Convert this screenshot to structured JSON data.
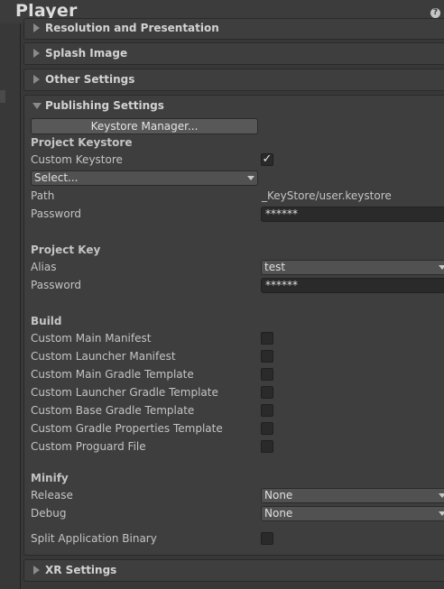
{
  "header": {
    "title": "Player"
  },
  "sections": {
    "resolution": "Resolution and Presentation",
    "splash": "Splash Image",
    "other": "Other Settings",
    "publishing": "Publishing Settings",
    "xr": "XR Settings"
  },
  "publishing": {
    "keystore_manager_button": "Keystore Manager...",
    "project_keystore": {
      "heading": "Project Keystore",
      "custom_keystore_label": "Custom Keystore",
      "custom_keystore_checked": true,
      "select_value": "Select...",
      "path_label": "Path",
      "path_value": "_KeyStore/user.keystore",
      "password_label": "Password",
      "password_value": "******"
    },
    "project_key": {
      "heading": "Project Key",
      "alias_label": "Alias",
      "alias_value": "test",
      "password_label": "Password",
      "password_value": "******"
    },
    "build": {
      "heading": "Build",
      "items": [
        {
          "label": "Custom Main Manifest",
          "checked": false
        },
        {
          "label": "Custom Launcher Manifest",
          "checked": false
        },
        {
          "label": "Custom Main Gradle Template",
          "checked": false
        },
        {
          "label": "Custom Launcher Gradle Template",
          "checked": false
        },
        {
          "label": "Custom Base Gradle Template",
          "checked": false
        },
        {
          "label": "Custom Gradle Properties Template",
          "checked": false
        },
        {
          "label": "Custom Proguard File",
          "checked": false
        }
      ]
    },
    "minify": {
      "heading": "Minify",
      "release_label": "Release",
      "release_value": "None",
      "debug_label": "Debug",
      "debug_value": "None"
    },
    "split_binary": {
      "label": "Split Application Binary",
      "checked": false
    }
  },
  "icons": {
    "help": "help-icon",
    "collapsed": "triangle-right-icon",
    "expanded": "triangle-down-icon"
  },
  "colors": {
    "background": "#383838",
    "section": "#3e3e3e",
    "field": "#2a2a2a",
    "button": "#585858"
  }
}
